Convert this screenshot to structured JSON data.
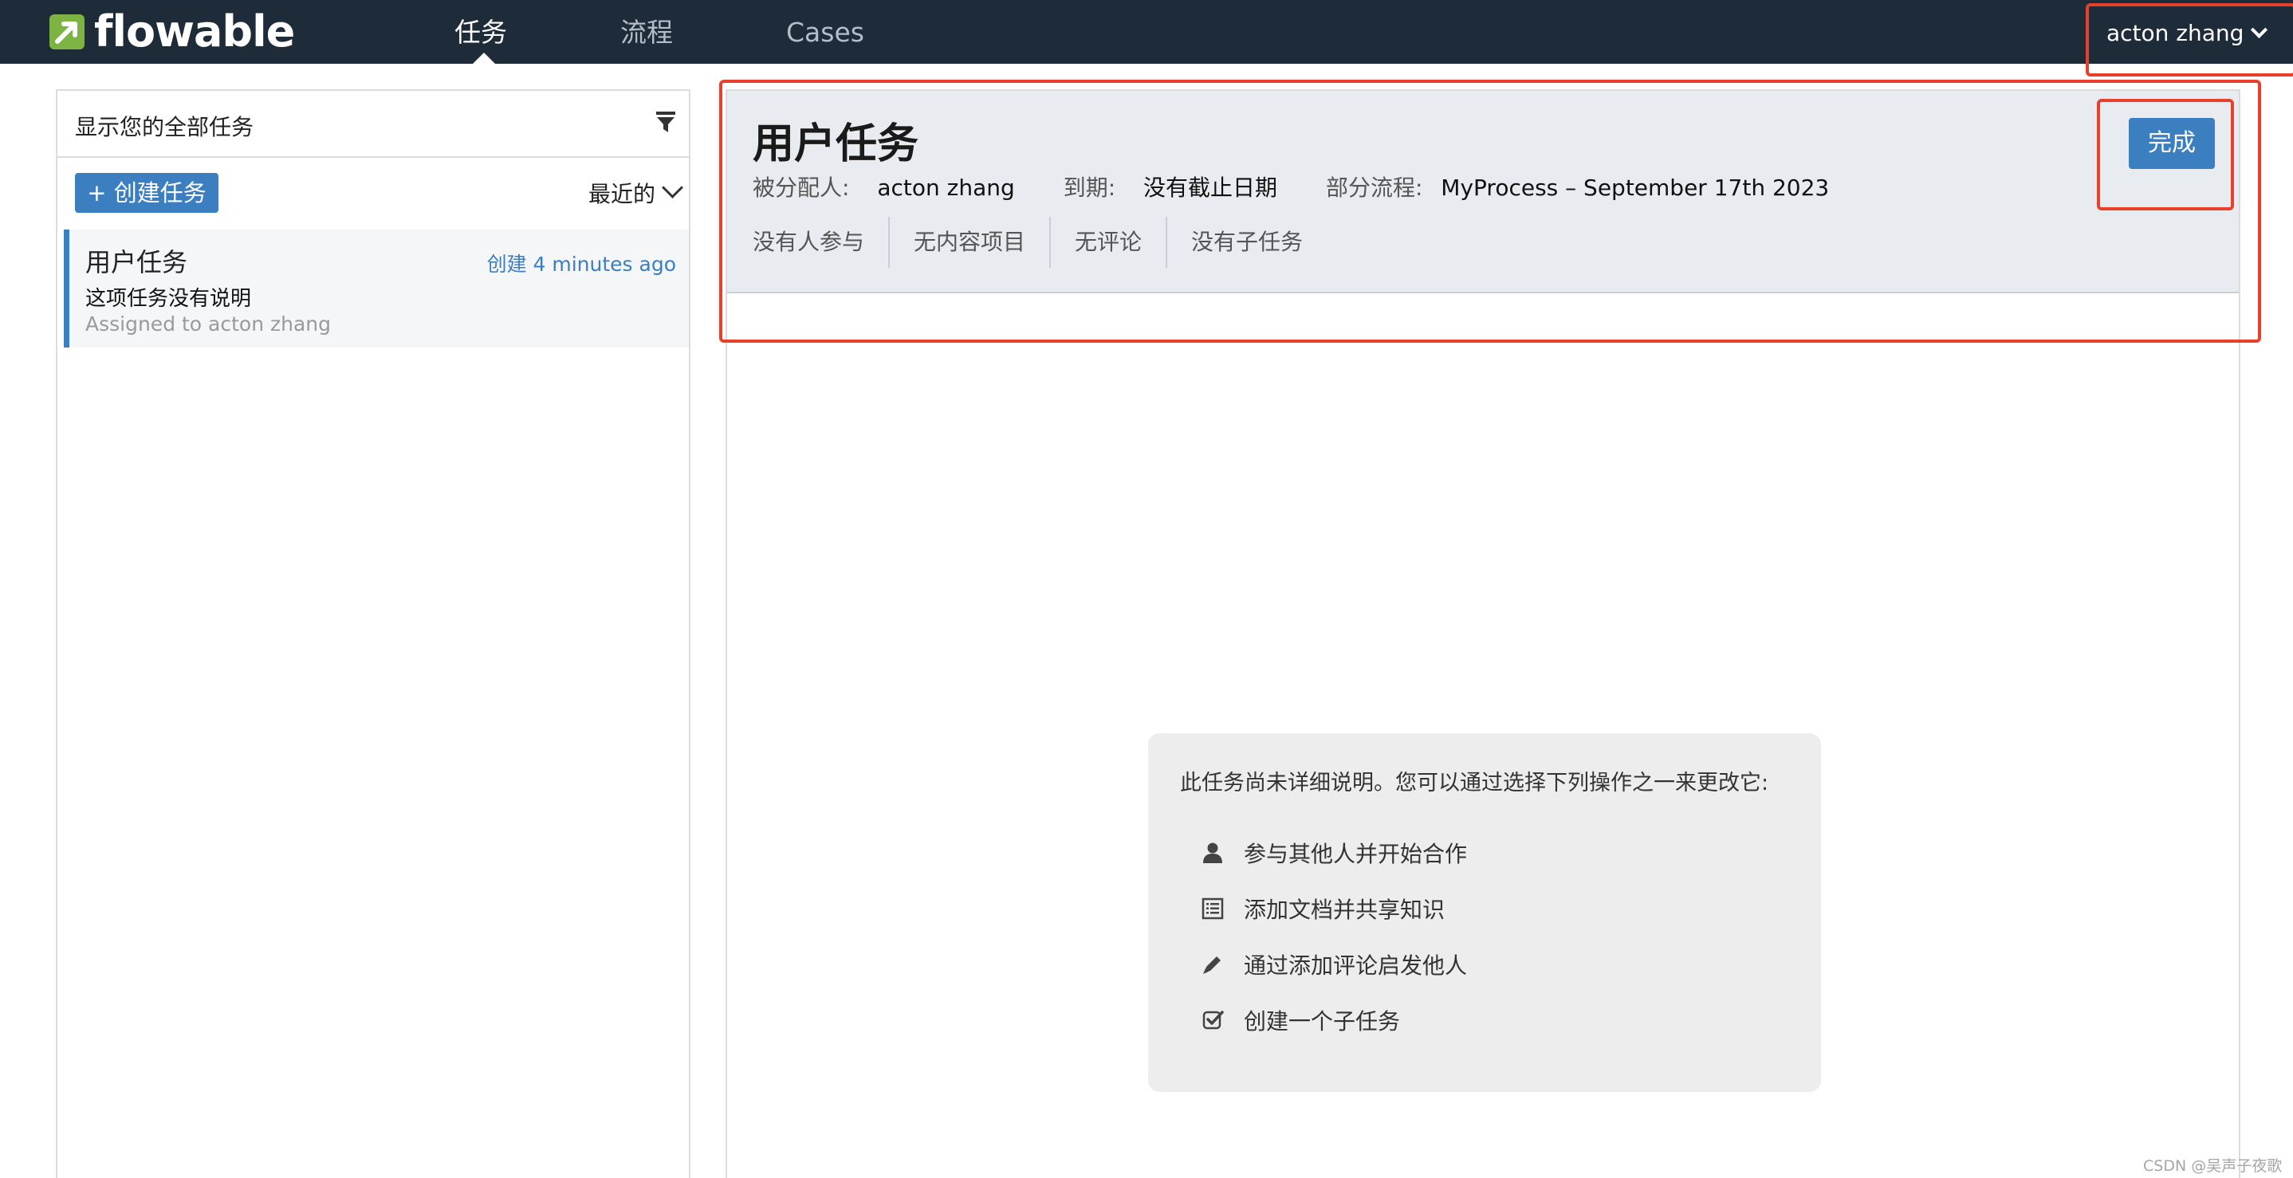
{
  "app": {
    "logo_text": "flowable",
    "brand_color": "#7cb342",
    "accent_color": "#3b7fc1",
    "nav_background": "#1e2b38"
  },
  "nav": {
    "tabs": [
      {
        "label": "任务",
        "active": true
      },
      {
        "label": "流程",
        "active": false
      },
      {
        "label": "Cases",
        "active": false
      }
    ],
    "user": "acton zhang"
  },
  "sidebar": {
    "filter_label": "显示您的全部任务",
    "create_button": "+ 创建任务",
    "sort_label": "最近的",
    "tasks": [
      {
        "title": "用户任务",
        "created": "创建 4 minutes ago",
        "description": "这项任务没有说明",
        "assigned": "Assigned to acton zhang"
      }
    ]
  },
  "task": {
    "title": "用户任务",
    "assignee_label": "被分配人:",
    "assignee": "acton zhang",
    "due_label": "到期:",
    "due": "没有截止日期",
    "process_label": "部分流程:",
    "process": "MyProcess – September 17th 2023",
    "complete_button": "完成",
    "stats": [
      "没有人参与",
      "无内容项目",
      "无评论",
      "没有子任务"
    ]
  },
  "help": {
    "intro": "此任务尚未详细说明。您可以通过选择下列操作之一来更改它:",
    "items": [
      {
        "icon": "user-icon",
        "label": "参与其他人并开始合作"
      },
      {
        "icon": "document-icon",
        "label": "添加文档并共享知识"
      },
      {
        "icon": "pencil-icon",
        "label": "通过添加评论启发他人"
      },
      {
        "icon": "checkbox-icon",
        "label": "创建一个子任务"
      }
    ]
  },
  "annotation_color": "#e8402a",
  "watermark": "CSDN @吴声子夜歌"
}
